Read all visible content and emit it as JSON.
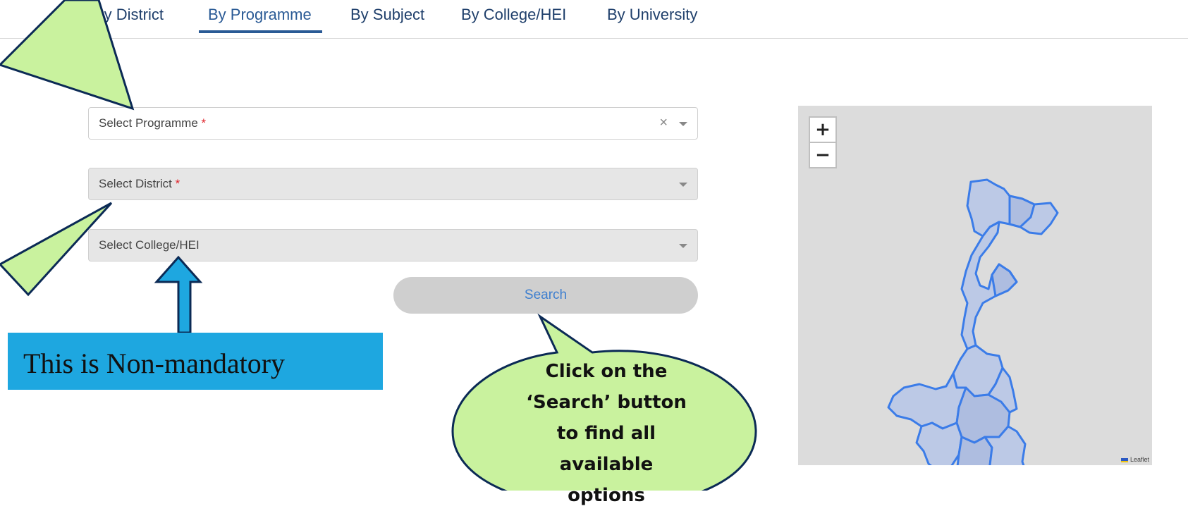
{
  "nav": {
    "tabs": [
      {
        "label": "By District"
      },
      {
        "label": "By Programme",
        "active": true
      },
      {
        "label": "By Subject"
      },
      {
        "label": "By College/HEI"
      },
      {
        "label": "By University"
      }
    ]
  },
  "form": {
    "programme": {
      "label": "Select Programme",
      "required_mark": "*",
      "clear_icon": "×"
    },
    "district": {
      "label": "Select District",
      "required_mark": "*"
    },
    "college": {
      "label": "Select College/HEI"
    },
    "search_label": "Search"
  },
  "map": {
    "zoom_in": "+",
    "zoom_out": "−",
    "attribution": "Leaflet"
  },
  "annotations": {
    "non_mandatory": "This is Non-mandatory",
    "search_callout_lines": [
      "Click on the",
      "‘Search’ button",
      "to find all",
      "available",
      "options"
    ]
  },
  "colors": {
    "callout_fill": "#c9f29e",
    "callout_stroke": "#0b2a55",
    "note_box": "#1ea7e0",
    "active_tab": "#2a5a95",
    "map_region_fill": "#bcc9e6",
    "map_region_stroke": "#3b7ce8"
  }
}
